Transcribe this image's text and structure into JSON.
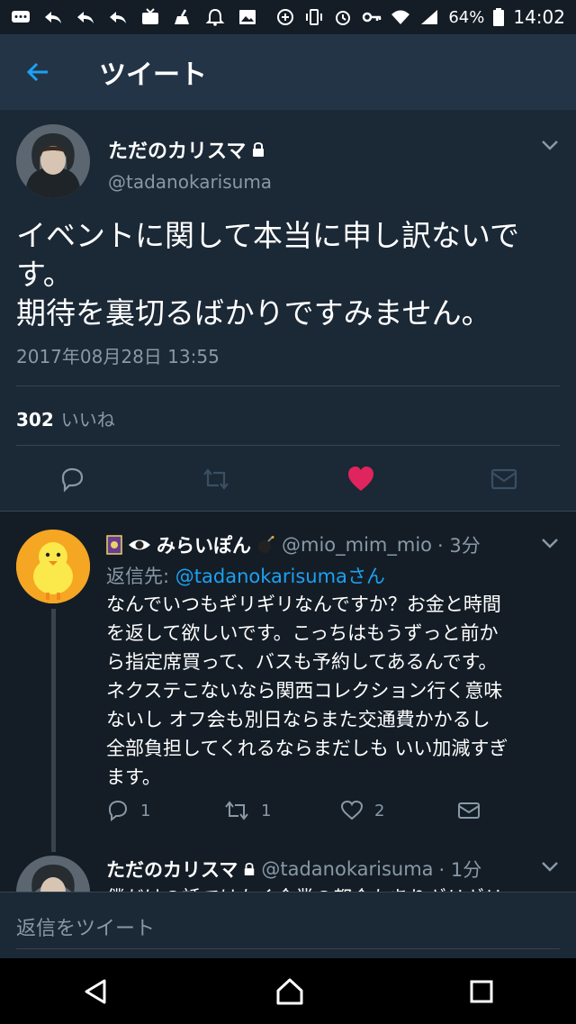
{
  "status_bar": {
    "battery": "64%",
    "time": "14:02",
    "left_icons": [
      "messages-icon",
      "reply-icon",
      "reply-icon",
      "reply-icon",
      "tv-icon",
      "broom-icon",
      "bell-icon",
      "image-icon"
    ],
    "right_icons": [
      "data-saver-icon",
      "vibrate-icon",
      "alarm-icon",
      "key-icon",
      "wifi-icon",
      "signal-icon",
      "battery-icon"
    ]
  },
  "header": {
    "title": "ツイート"
  },
  "tweet": {
    "display_name": "ただのカリスマ",
    "handle": "@tadanokarisuma",
    "text_line1": "イベントに関して本当に申し訳ないで",
    "text_line2": "す。",
    "text_line3": "期待を裏切るばかりですみません。",
    "timestamp": "2017年08月28日 13:55",
    "likes_count": "302",
    "likes_label": "いいね"
  },
  "reply": {
    "display_name": "みらいぽん",
    "handle": "@mio_mim_mio",
    "time": "· 3分",
    "replying_to_label": "返信先:",
    "replying_to_handle": "@tadanokarisuma",
    "replying_to_suffix": "さん",
    "lines": [
      "なんでいつもギリギリなんですか？お金と時間",
      "を返して欲しいです。こっちはもうずっと前か",
      "ら指定席買って、バスも予約してあるんです。",
      "ネクステこないなら関西コレクション行く意味",
      "ないし オフ会も別日ならまた交通費かかるし",
      "全部負担してくれるならまだしも いい加減すぎ",
      "ます。"
    ],
    "reply_count": "1",
    "retweet_count": "1",
    "like_count": "2"
  },
  "reply2": {
    "display_name": "ただのカリスマ",
    "handle": "@tadanokarisuma",
    "time": "· 1分",
    "peek_text": "僕だけの話ではなく企業の都合もありギリギリ"
  },
  "composer": {
    "placeholder": "返信をツイート"
  },
  "colors": {
    "accent": "#1da1f2",
    "like": "#e0245e",
    "background": "#141d26",
    "muted": "#8899a6"
  }
}
